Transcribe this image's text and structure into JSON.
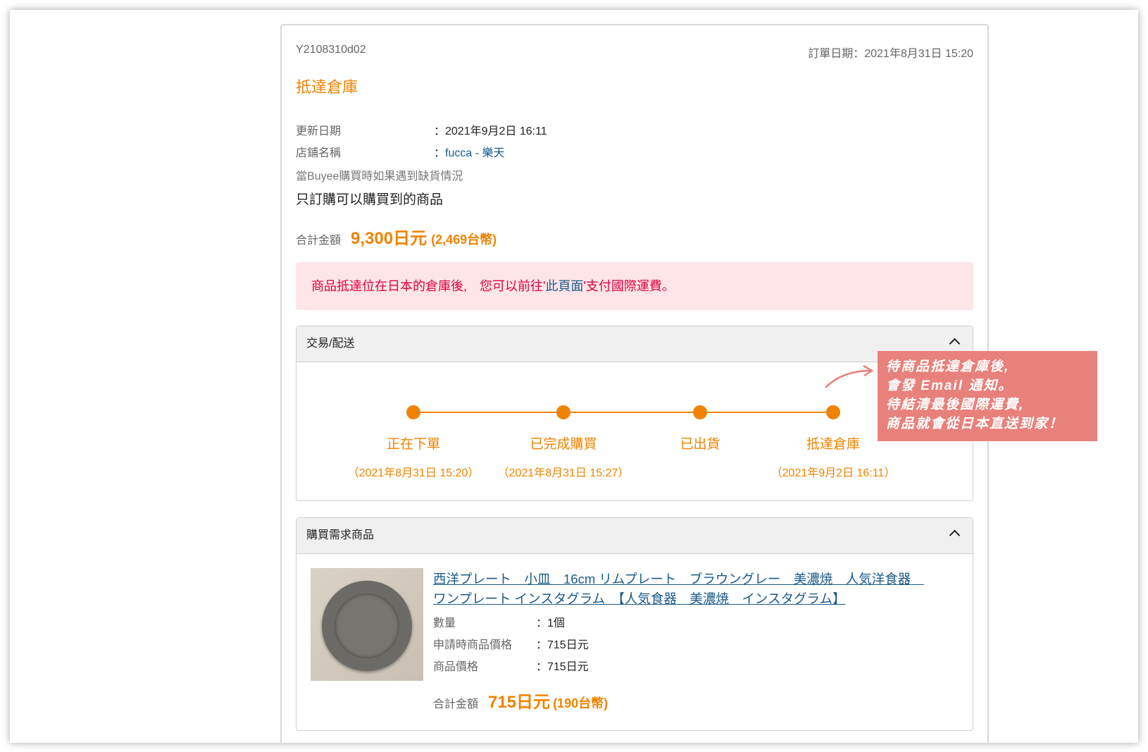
{
  "order": {
    "id": "Y2108310d02",
    "date": "訂單日期：2021年8月31日 15:20",
    "status": "抵達倉庫",
    "update_label": "更新日期",
    "update_value": "：2021年9月2日 16:11",
    "shop_label": "店鋪名稱",
    "shop_colon": "：",
    "shop_value": "fucca - 樂天",
    "stock_label": "當Buyee購買時如果遇到缺貨情況",
    "stock_value": "只訂購可以購買到的商品",
    "total_label": "合計金額",
    "total_jpy": "9,300日元",
    "total_twd": "(2,469台幣)"
  },
  "alert": {
    "prefix": "商品抵達位在日本的倉庫後,　您可以前往'",
    "link": "此頁面",
    "suffix": "'支付國際運費。"
  },
  "shipping_panel": {
    "title": "交易/配送",
    "steps": [
      {
        "label": "正在下單",
        "date": "（2021年8月31日 15:20）"
      },
      {
        "label": "已完成購買",
        "date": "（2021年8月31日 15:27）"
      },
      {
        "label": "已出貨",
        "date": ""
      },
      {
        "label": "抵達倉庫",
        "date": "（2021年9月2日 16:11）"
      }
    ]
  },
  "product_panel": {
    "title": "購買需求商品",
    "product_title": "西洋プレート　小皿　16cm リムプレート　ブラウングレー　美濃焼　人気洋食器　ワンプレート インスタグラム　【人気食器　美濃焼　インスタグラム】",
    "qty_label": "數量",
    "qty_value": "：1個",
    "req_price_label": "申請時商品價格",
    "req_price_value": "：715日元",
    "price_label": "商品價格",
    "price_value": "：715日元",
    "total_label": "合計金額",
    "total_jpy": "715日元",
    "total_twd": "(190台幣)"
  },
  "callout": {
    "line1": "待商品抵達倉庫後,",
    "line2": "會發 Email 通知。",
    "line3": "待結清最後國際運費,",
    "line4": "商品就會從日本直送到家！"
  },
  "colors": {
    "accent": "#f08300",
    "link": "#1a5a8a",
    "alert_bg": "#fde5e8",
    "alert_text": "#e4003a",
    "callout_bg": "#e8807c"
  }
}
